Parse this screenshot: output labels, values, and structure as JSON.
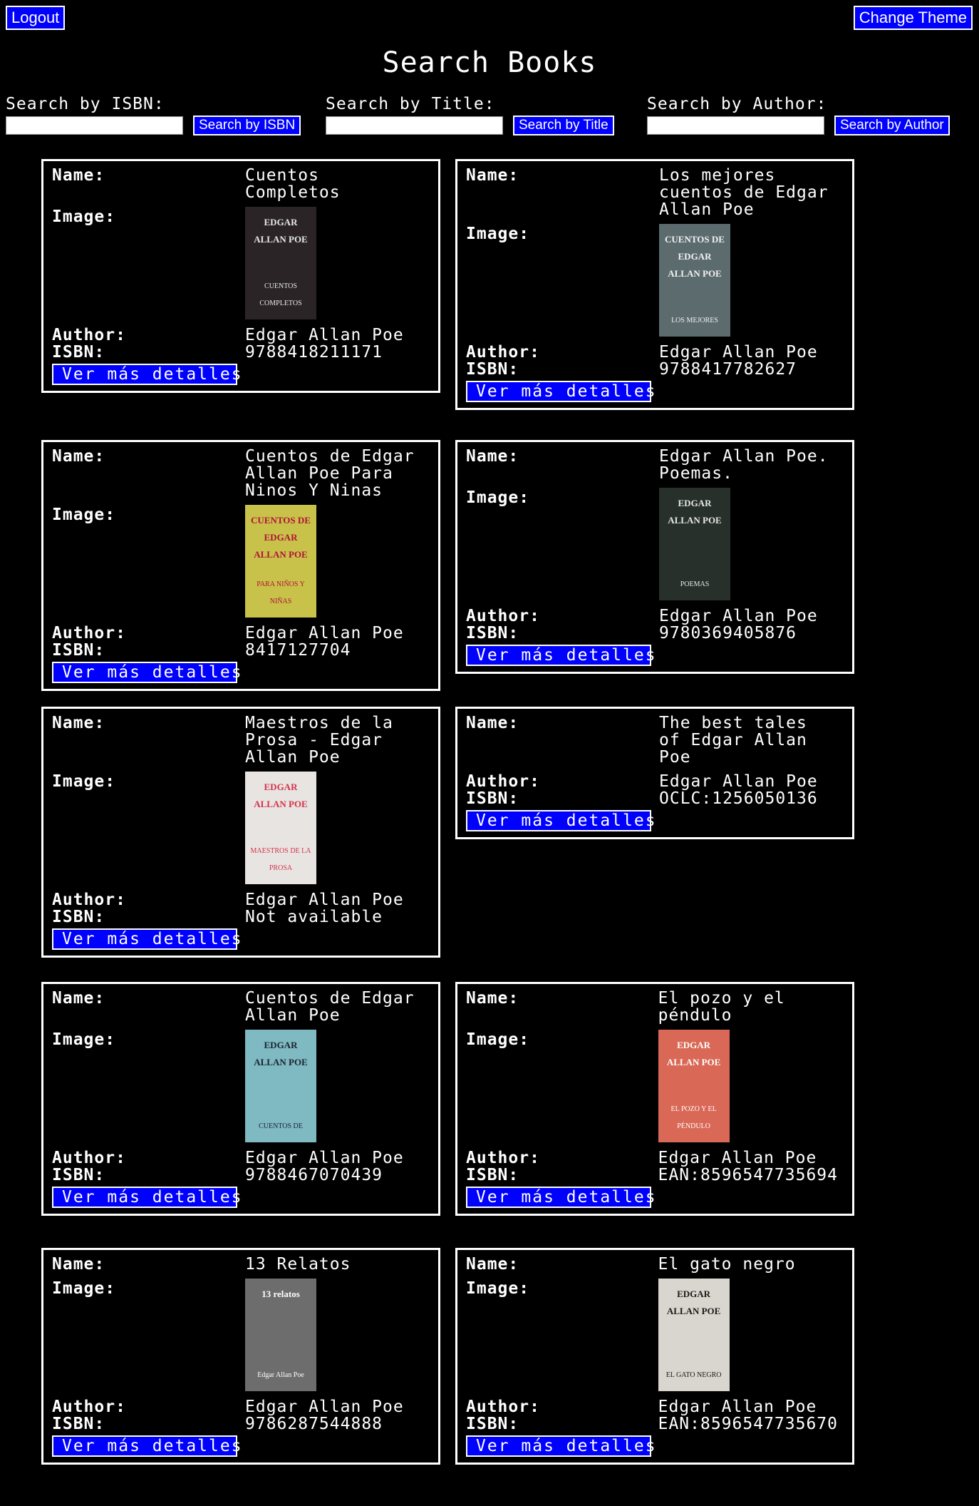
{
  "header": {
    "logout_label": "Logout",
    "theme_label": "Change Theme",
    "title": "Search Books"
  },
  "search": {
    "isbn": {
      "label": "Search by ISBN:",
      "value": "",
      "button": "Search by ISBN"
    },
    "title": {
      "label": "Search by Title:",
      "value": "",
      "button": "Search by Title"
    },
    "author": {
      "label": "Search by Author:",
      "value": "",
      "button": "Search by Author"
    }
  },
  "labels": {
    "name": "Name:",
    "image": "Image:",
    "author": "Author:",
    "isbn": "ISBN:",
    "more": "Ver más detalles"
  },
  "colors": {
    "accent": "#0000ff",
    "background": "#000000",
    "text": "#ffffff"
  },
  "books": [
    {
      "name": "Cuentos Completos",
      "author": "Edgar Allan Poe",
      "isbn": "9788418211171",
      "cover_title": "EDGAR ALLAN POE",
      "cover_sub": "CUENTOS COMPLETOS"
    },
    {
      "name": "Los mejores cuentos de Edgar Allan Poe",
      "author": "Edgar Allan Poe",
      "isbn": "9788417782627",
      "cover_title": "CUENTOS DE EDGAR ALLAN POE",
      "cover_sub": "LOS MEJORES"
    },
    {
      "name": "Cuentos de Edgar Allan Poe Para Ninos Y Ninas",
      "author": "Edgar Allan Poe",
      "isbn": "8417127704",
      "cover_title": "CUENTOS DE EDGAR ALLAN POE",
      "cover_sub": "PARA NIÑOS Y NIÑAS"
    },
    {
      "name": "Edgar Allan Poe. Poemas.",
      "author": "Edgar Allan Poe",
      "isbn": "9780369405876",
      "cover_title": "EDGAR ALLAN POE",
      "cover_sub": "POEMAS"
    },
    {
      "name": "Maestros de la Prosa - Edgar Allan Poe",
      "author": "Edgar Allan Poe",
      "isbn": "Not available",
      "cover_title": "EDGAR ALLAN POE",
      "cover_sub": "MAESTROS DE LA PROSA"
    },
    {
      "name": "The best tales of Edgar Allan Poe",
      "author": "Edgar Allan Poe",
      "isbn": "OCLC:1256050136"
    },
    {
      "name": "Cuentos de Edgar Allan Poe",
      "author": "Edgar Allan Poe",
      "isbn": "9788467070439",
      "cover_title": "EDGAR ALLAN POE",
      "cover_sub": "CUENTOS DE"
    },
    {
      "name": "El pozo y el péndulo",
      "author": "Edgar Allan Poe",
      "isbn": "EAN:8596547735694",
      "cover_title": "EDGAR ALLAN POE",
      "cover_sub": "EL POZO Y EL PÉNDULO"
    },
    {
      "name": "13 Relatos",
      "author": "Edgar Allan Poe",
      "isbn": "9786287544888",
      "cover_title": "13 relatos",
      "cover_sub": "Edgar Allan Poe"
    },
    {
      "name": "El gato negro",
      "author": "Edgar Allan Poe",
      "isbn": "EAN:8596547735670",
      "cover_title": "EDGAR ALLAN POE",
      "cover_sub": "EL GATO NEGRO"
    }
  ]
}
